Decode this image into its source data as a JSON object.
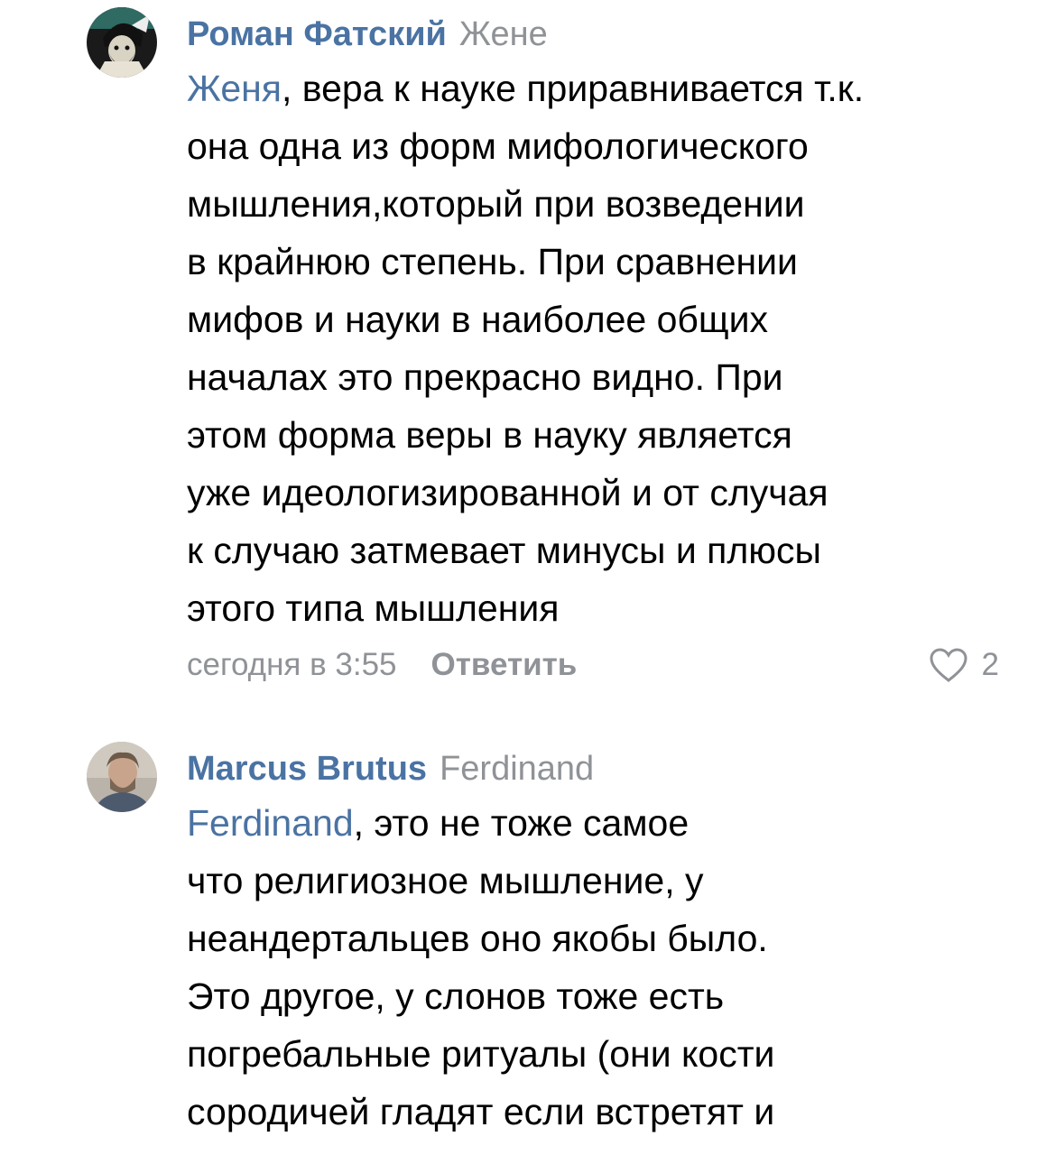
{
  "comments": [
    {
      "author": "Роман Фатский",
      "reply_to": "Жене",
      "mention": "Женя",
      "text": ", вера к науке приравнивается т.к.\nона одна из форм мифологического\nмышления,который при возведении\nв крайнюю степень. При сравнении\nмифов и науки в наиболее общих\nначалах это прекрасно видно. При\nэтом форма веры в науку является\nуже идеологизированной и от случая\nк случаю затмевает минусы и плюсы\nэтого типа мышления",
      "time": "сегодня в 3:55",
      "reply_label": "Ответить",
      "likes": "2",
      "avatar_icon": "avatar-cartoon-icon"
    },
    {
      "author": "Marcus Brutus",
      "reply_to": "Ferdinand",
      "mention": "Ferdinand",
      "text": ", это не тоже самое\nчто религиозное мышление, у\nнеандертальцев оно якобы было.\nЭто другое, у слонов тоже есть\nпогребальные ритуалы (они кости\nсородичей гладят если встретят и",
      "avatar_icon": "avatar-photo-icon"
    }
  ],
  "colors": {
    "author": "#4a73a3",
    "meta": "#8f9296",
    "text": "#000000",
    "background": "#ffffff"
  },
  "icons": {
    "like": "heart-outline-icon"
  }
}
